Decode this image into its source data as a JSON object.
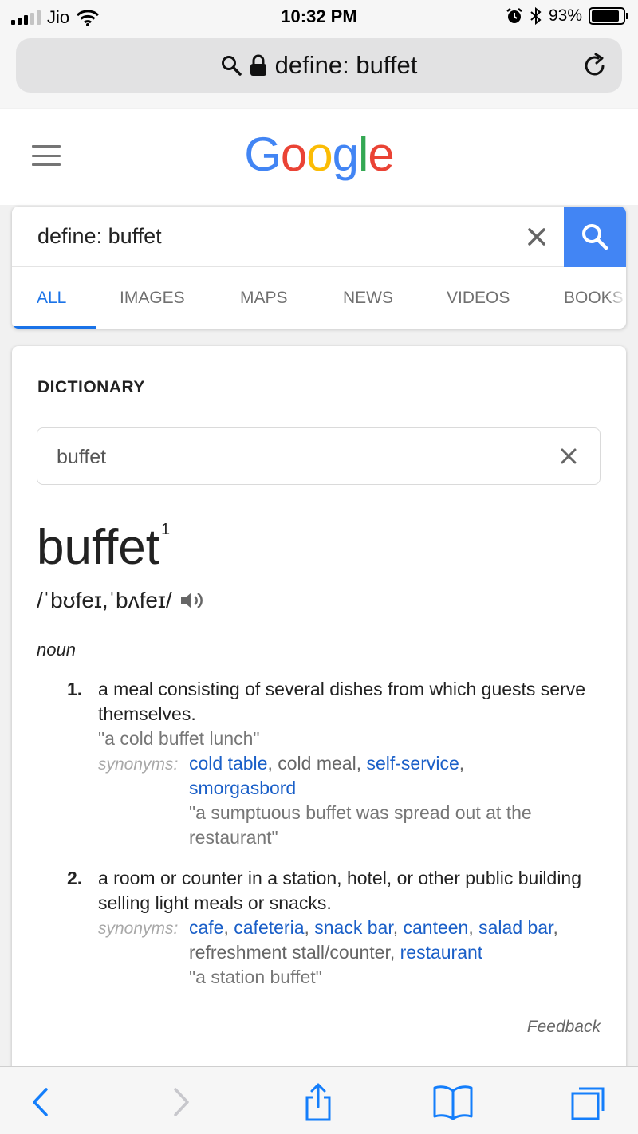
{
  "status_bar": {
    "carrier": "Jio",
    "time": "10:32 PM",
    "battery": "93%"
  },
  "address_bar": {
    "url_text": "define: buffet"
  },
  "google": {
    "logo_text": "Google",
    "logo_colors": [
      "#4285F4",
      "#EA4335",
      "#FBBC05",
      "#4285F4",
      "#34A853",
      "#EA4335"
    ]
  },
  "search": {
    "query": "define: buffet",
    "tabs": [
      "ALL",
      "IMAGES",
      "MAPS",
      "NEWS",
      "VIDEOS",
      "BOOKS"
    ],
    "active_tab": "ALL"
  },
  "dictionary": {
    "title": "DICTIONARY",
    "input_value": "buffet",
    "headword": "buffet",
    "superscript": "1",
    "pronunciation": "/ˈbʊfeɪ,ˈbʌfeɪ/",
    "part_of_speech": "noun",
    "senses": [
      {
        "number": "1.",
        "definition": "a meal consisting of several dishes from which guests serve themselves.",
        "example": "\"a cold buffet lunch\"",
        "synonyms_label": "synonyms:",
        "synonyms": [
          "cold table",
          "cold meal",
          "self-service",
          "smorgasbord"
        ],
        "synonym_example": "\"a sumptuous buffet was spread out at the restaurant\""
      },
      {
        "number": "2.",
        "definition": "a room or counter in a station, hotel, or other public building selling light meals or snacks.",
        "synonyms_label": "synonyms:",
        "synonyms": [
          "cafe",
          "cafeteria",
          "snack bar",
          "canteen",
          "salad bar",
          "refreshment stall/counter",
          "restaurant"
        ],
        "synonym_example": "\"a station buffet\""
      }
    ],
    "feedback": "Feedback"
  },
  "colors": {
    "link": "#1a5fc8",
    "accent": "#4285f4",
    "safari_blue": "#147efb"
  }
}
